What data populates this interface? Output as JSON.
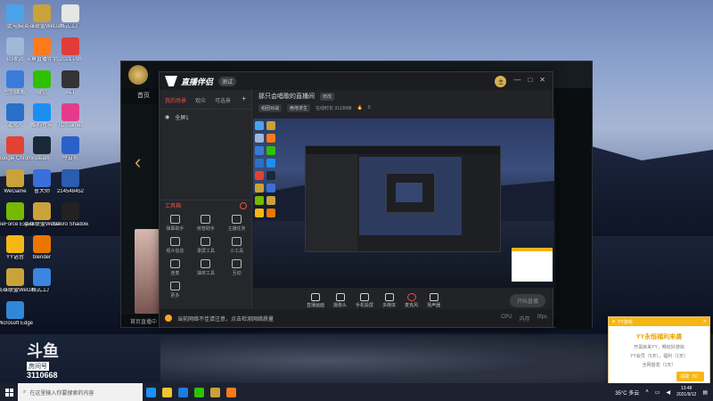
{
  "desktop": {
    "col1": [
      {
        "label": "此电脑",
        "color": "#4aa3e8",
        "icon": "computer-icon"
      },
      {
        "label": "回收站",
        "color": "#9fb8d6",
        "icon": "recycle-bin-icon"
      },
      {
        "label": "控制面板",
        "color": "#3b7bd8",
        "icon": "control-panel-icon"
      },
      {
        "label": "逢火人",
        "color": "#2a6fc9",
        "icon": "app-icon"
      },
      {
        "label": "Google Chrome",
        "color": "#e34133",
        "icon": "chrome-icon"
      },
      {
        "label": "WeGame",
        "color": "#c9a23a",
        "icon": "wegame-icon"
      },
      {
        "label": "GeForce Experience",
        "color": "#76b900",
        "icon": "geforce-icon"
      },
      {
        "label": "YY语音",
        "color": "#f6b715",
        "icon": "yy-icon"
      },
      {
        "label": "英雄联盟WeGame版",
        "color": "#c9a23a",
        "icon": "lol-icon"
      },
      {
        "label": "Microsoft Edge",
        "color": "#2f87d8",
        "icon": "edge-icon"
      }
    ],
    "col2": [
      {
        "label": "英雄联盟WeGame版",
        "color": "#c9a23a",
        "icon": "lol-icon"
      },
      {
        "label": "斗鱼直播伴侣",
        "color": "#ff7a1a",
        "icon": "douyu-icon"
      },
      {
        "label": "微信",
        "color": "#2dc100",
        "icon": "wechat-icon"
      },
      {
        "label": "酷狗音乐",
        "color": "#1c8ef2",
        "icon": "kugou-icon"
      },
      {
        "label": "Steam",
        "color": "#1b2838",
        "icon": "steam-icon"
      },
      {
        "label": "鲁大师",
        "color": "#3b6fd8",
        "icon": "ludashi-icon"
      },
      {
        "label": "英雄联盟WeGame版",
        "color": "#c9a23a",
        "icon": "lol-icon"
      },
      {
        "label": "blender",
        "color": "#ea7600",
        "icon": "blender-icon"
      },
      {
        "label": "格式工厂",
        "color": "#3a86e0",
        "icon": "format-factory-icon"
      }
    ],
    "col3": [
      {
        "label": "格式工厂",
        "color": "#e6e6e6",
        "icon": "app-icon"
      },
      {
        "label": "2021 Pdf",
        "color": "#e23b3b",
        "icon": "pdf-icon"
      },
      {
        "label": "ALT",
        "color": "#333",
        "icon": "app-icon"
      },
      {
        "label": "TC Games",
        "color": "#e23b8b",
        "icon": "tcgames-icon"
      },
      {
        "label": "今日剪",
        "color": "#2b5fc9",
        "icon": "word-icon"
      },
      {
        "label": "214548452",
        "color": "#2a5cb0",
        "icon": "app-icon"
      },
      {
        "label": "Sekiro Shadows",
        "color": "#222",
        "icon": "sekiro-icon"
      }
    ]
  },
  "back_window": {
    "nav": [
      "首页",
      "",
      ""
    ],
    "bottom": [
      "首页直播中",
      "",
      ""
    ]
  },
  "live_window": {
    "app_name": "直播伴侣",
    "version": "测试",
    "avatar": "主",
    "controls": [
      "—",
      "□",
      "✕"
    ],
    "tabs": [
      "我的场景",
      "观众",
      "可选景"
    ],
    "scene": "全屏1",
    "tools_title": "工具箱",
    "tools": [
      "弹幕助手",
      "房管助手",
      "主播任务",
      "观众信息",
      "录屏工具",
      "小工具",
      "连麦",
      "抽奖工具",
      "互动",
      "更多"
    ],
    "title": "那只会唱歌的直播间",
    "edit": "修改",
    "sub": [
      "组团对战",
      "绝地求生",
      "在线时长 3113688",
      "0"
    ],
    "bottom_controls": [
      {
        "label": "直播画面",
        "mic": false
      },
      {
        "label": "摄像头",
        "mic": false
      },
      {
        "label": "手机投屏",
        "mic": false
      },
      {
        "label": "多媒体",
        "mic": false
      },
      {
        "label": "麦克风",
        "mic": true
      },
      {
        "label": "扬声器",
        "mic": false
      }
    ],
    "start_button": "开始直播",
    "status": "当前网络不佳请注意，点击检测网络质量",
    "status_right": [
      "CPU",
      "内存",
      "0fps"
    ]
  },
  "watermark": {
    "top": "斗鱼",
    "tag": "房间号",
    "num": "3110668"
  },
  "notification": {
    "bar": "YY游戏",
    "title": "YY永恒福利来袭",
    "lines": [
      "开黑就来YY，畅玩好游戏",
      "YY会员（5天），福利（1天）",
      "全网首发（1天）"
    ],
    "button": "领取（5）"
  },
  "taskbar": {
    "search_placeholder": "在这里输入你要搜索的内容",
    "apps": [
      {
        "color": "#1e90ff",
        "icon": "task-view-icon"
      },
      {
        "color": "#f1c232",
        "icon": "file-explorer-icon"
      },
      {
        "color": "#1e7be0",
        "icon": "edge-icon"
      },
      {
        "color": "#2dc100",
        "icon": "wechat-icon"
      },
      {
        "color": "#c9a23a",
        "icon": "lol-icon"
      },
      {
        "color": "#ff7a1a",
        "icon": "douyu-icon"
      }
    ],
    "weather": "35°C 多云",
    "time": "13:48",
    "date": "2021/9/12"
  }
}
